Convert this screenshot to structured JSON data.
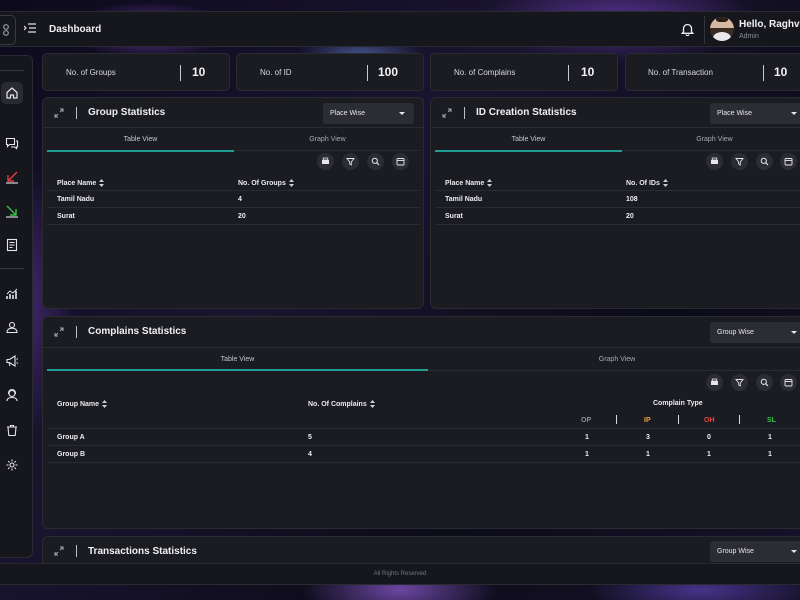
{
  "header": {
    "title": "Dashboard",
    "user_name": "Hello, Raghva",
    "user_role": "Admin"
  },
  "stats": [
    {
      "label": "No. of Groups",
      "value": "10"
    },
    {
      "label": "No. of ID",
      "value": "100"
    },
    {
      "label": "No. of Complains",
      "value": "10"
    },
    {
      "label": "No. of Transaction",
      "value": "10"
    }
  ],
  "group_stats": {
    "title": "Group Statistics",
    "dropdown": "Place Wise",
    "tabs": [
      "Table View",
      "Graph View"
    ],
    "columns": [
      "Place Name",
      "No. Of Groups"
    ],
    "rows": [
      [
        "Tamil Nadu",
        "4"
      ],
      [
        "Surat",
        "20"
      ]
    ]
  },
  "id_stats": {
    "title": "ID Creation Statistics",
    "dropdown": "Place Wise",
    "tabs": [
      "Table View",
      "Graph View"
    ],
    "columns": [
      "Place Name",
      "No. Of IDs"
    ],
    "rows": [
      [
        "Tamil Nadu",
        "108"
      ],
      [
        "Surat",
        "20"
      ]
    ]
  },
  "complain_stats": {
    "title": "Complains Statistics",
    "dropdown": "Group Wise",
    "tabs": [
      "Table View",
      "Graph View"
    ],
    "columns": [
      "Group Name",
      "No. Of Complains",
      "Complain Type"
    ],
    "types": [
      "OP",
      "IP",
      "OH",
      "SL"
    ],
    "rows": [
      [
        "Group A",
        "5",
        "1",
        "3",
        "0",
        "1"
      ],
      [
        "Group B",
        "4",
        "1",
        "1",
        "1",
        "1"
      ]
    ]
  },
  "transaction_stats": {
    "title": "Transactions Statistics",
    "dropdown": "Group Wise"
  },
  "footer": "All Rights Reserved",
  "colors": {
    "accent": "#1f9e93",
    "ip": "#e8a33b",
    "oh": "#e04646",
    "sl": "#37c24a",
    "op": "#8f9096"
  },
  "icons": [
    "menu-icon",
    "bell-icon",
    "home-icon",
    "chat-icon",
    "arrow-down-left-icon",
    "arrow-down-right-icon",
    "report-icon",
    "chart-icon",
    "user-icon",
    "megaphone-icon",
    "support-icon",
    "trash-icon",
    "settings-icon",
    "expand-icon",
    "print-icon",
    "filter-icon",
    "search-icon",
    "calendar-icon",
    "sort-icon"
  ]
}
